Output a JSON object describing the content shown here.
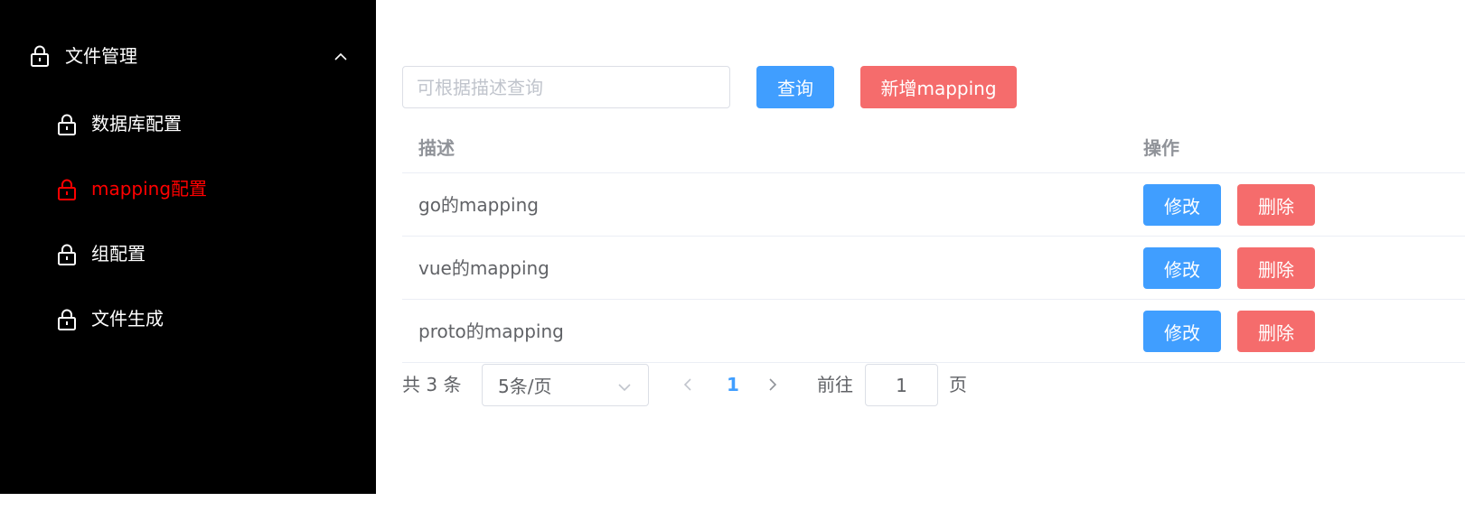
{
  "sidebar": {
    "group_title": "文件管理",
    "group_icon": "lock-icon",
    "group_toggle_icon": "chevron-up-icon",
    "items": [
      {
        "label": "数据库配置",
        "icon": "lock-icon",
        "active": false
      },
      {
        "label": "mapping配置",
        "icon": "lock-icon",
        "active": true
      },
      {
        "label": "组配置",
        "icon": "lock-icon",
        "active": false
      },
      {
        "label": "文件生成",
        "icon": "lock-icon",
        "active": false
      }
    ],
    "background_color": "#000000",
    "active_color": "#ff0000"
  },
  "toolbar": {
    "search_placeholder": "可根据描述查询",
    "search_value": "",
    "search_button": "查询",
    "add_button": "新增mapping"
  },
  "table": {
    "columns": [
      "描述",
      "操作"
    ],
    "rows": [
      {
        "desc": "go的mapping",
        "edit": "修改",
        "delete": "删除"
      },
      {
        "desc": "vue的mapping",
        "edit": "修改",
        "delete": "删除"
      },
      {
        "desc": "proto的mapping",
        "edit": "修改",
        "delete": "删除"
      }
    ]
  },
  "pagination": {
    "total_text": "共 3 条",
    "page_size": "5条/页",
    "current_page": "1",
    "goto_label": "前往",
    "goto_value": "1",
    "page_suffix": "页"
  },
  "colors": {
    "primary": "#409eff",
    "danger": "#f56c6c"
  }
}
